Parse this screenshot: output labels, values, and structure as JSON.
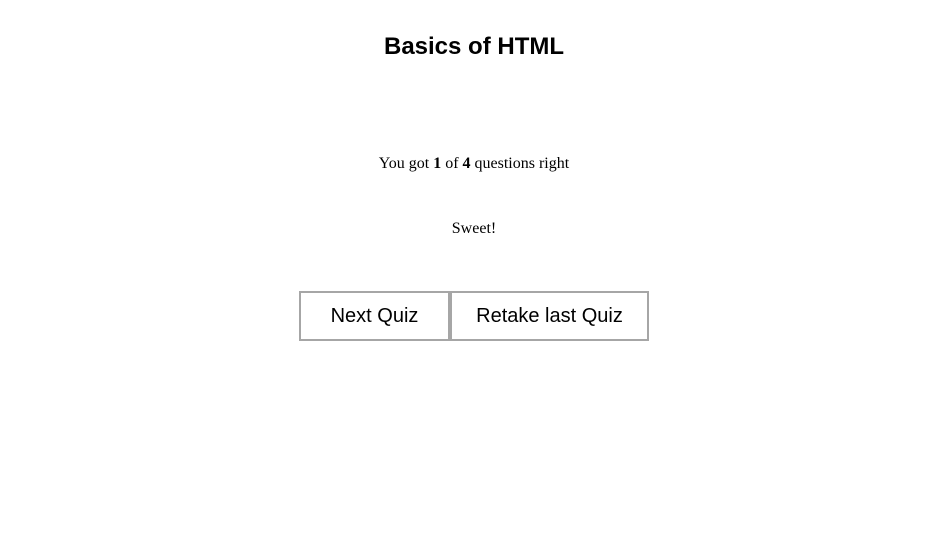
{
  "header": {
    "title": "Basics of HTML"
  },
  "result": {
    "prefix": "You got",
    "correct": "1",
    "of": "of",
    "total": "4",
    "suffix": "questions right",
    "feedback": "Sweet!"
  },
  "actions": {
    "next_label": "Next Quiz",
    "retake_label": "Retake last Quiz"
  }
}
